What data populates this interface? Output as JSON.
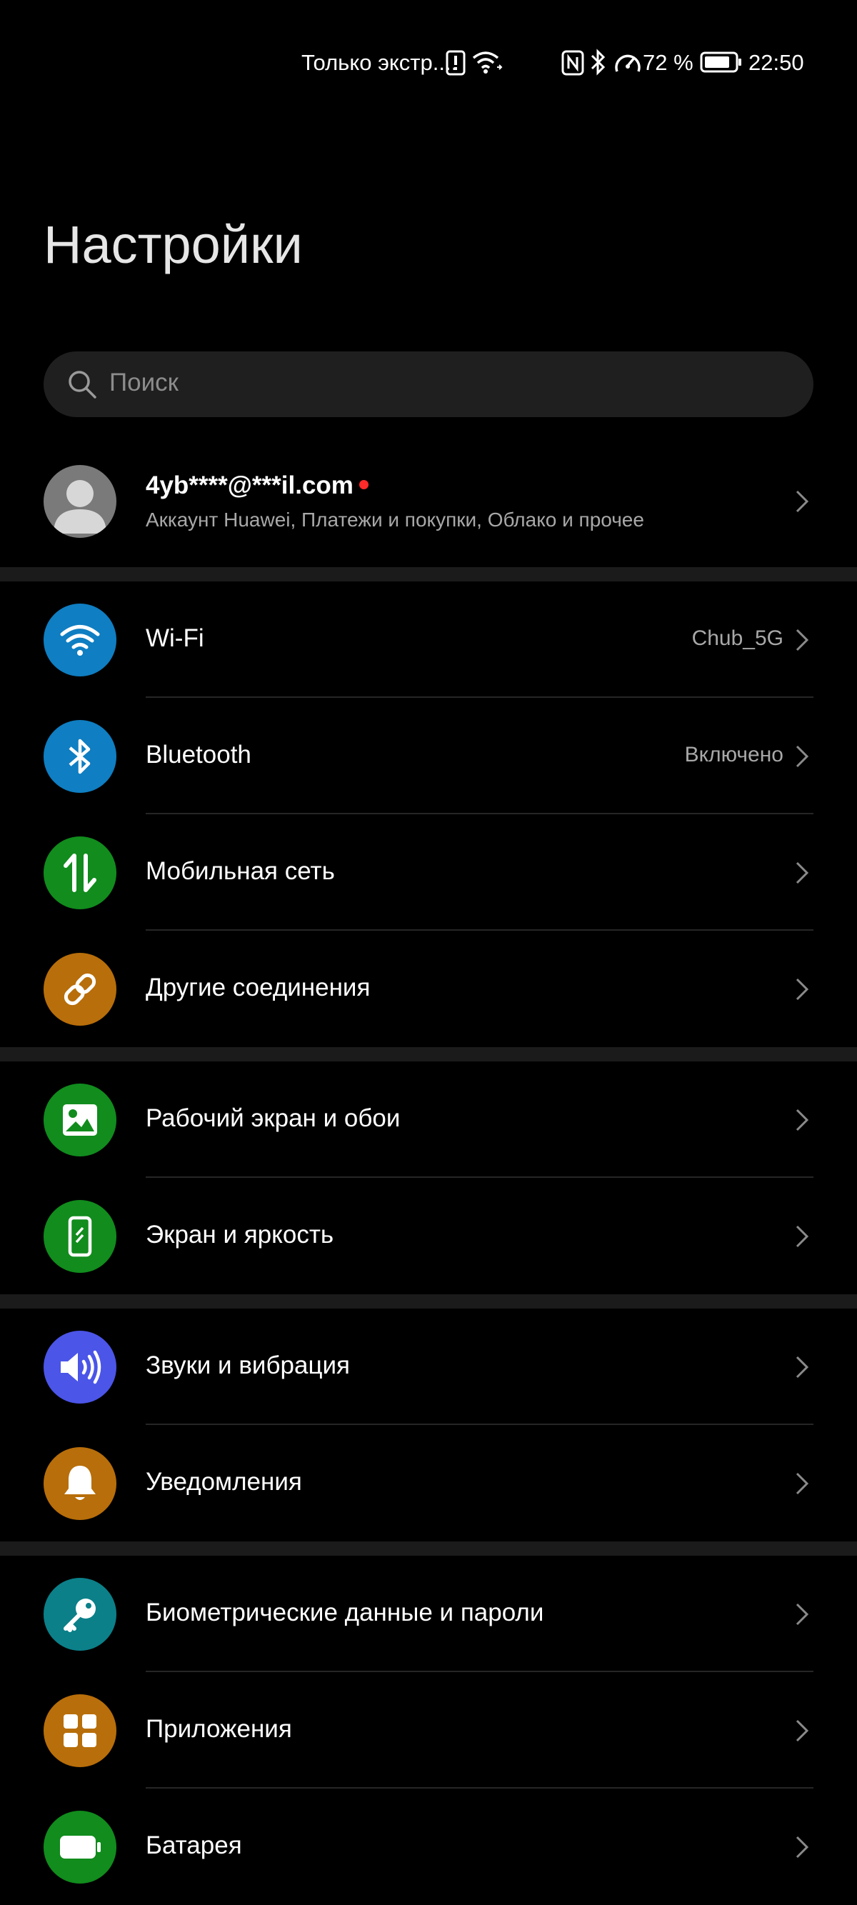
{
  "status_bar": {
    "carrier": "Только экстр....",
    "battery": "72 %",
    "time": "22:50"
  },
  "header": {
    "title": "Настройки"
  },
  "search": {
    "placeholder": "Поиск"
  },
  "account": {
    "email": "4yb****@***il.com",
    "subtitle": "Аккаунт Huawei, Платежи и покупки, Облако и прочее"
  },
  "groups": [
    {
      "items": [
        {
          "label": "Wi-Fi",
          "value": "Chub_5G",
          "icon": "wifi-icon",
          "color": "#0f7ec2"
        },
        {
          "label": "Bluetooth",
          "value": "Включено",
          "icon": "bluetooth-icon",
          "color": "#0f7ec2"
        },
        {
          "label": "Мобильная сеть",
          "value": "",
          "icon": "mobile-data-icon",
          "color": "#118c1d"
        },
        {
          "label": "Другие соединения",
          "value": "",
          "icon": "link-icon",
          "color": "#b86e0a"
        }
      ]
    },
    {
      "items": [
        {
          "label": "Рабочий экран и обои",
          "value": "",
          "icon": "wallpaper-icon",
          "color": "#118c1d"
        },
        {
          "label": "Экран и яркость",
          "value": "",
          "icon": "display-icon",
          "color": "#118c1d"
        }
      ]
    },
    {
      "items": [
        {
          "label": "Звуки и вибрация",
          "value": "",
          "icon": "sound-icon",
          "color": "#4b55e8"
        },
        {
          "label": "Уведомления",
          "value": "",
          "icon": "bell-icon",
          "color": "#b86e0a"
        }
      ]
    },
    {
      "items": [
        {
          "label": "Биометрические данные и пароли",
          "value": "",
          "icon": "key-icon",
          "color": "#0b8089"
        },
        {
          "label": "Приложения",
          "value": "",
          "icon": "apps-icon",
          "color": "#b86e0a"
        },
        {
          "label": "Батарея",
          "value": "",
          "icon": "battery-icon",
          "color": "#118c1d"
        }
      ]
    }
  ]
}
